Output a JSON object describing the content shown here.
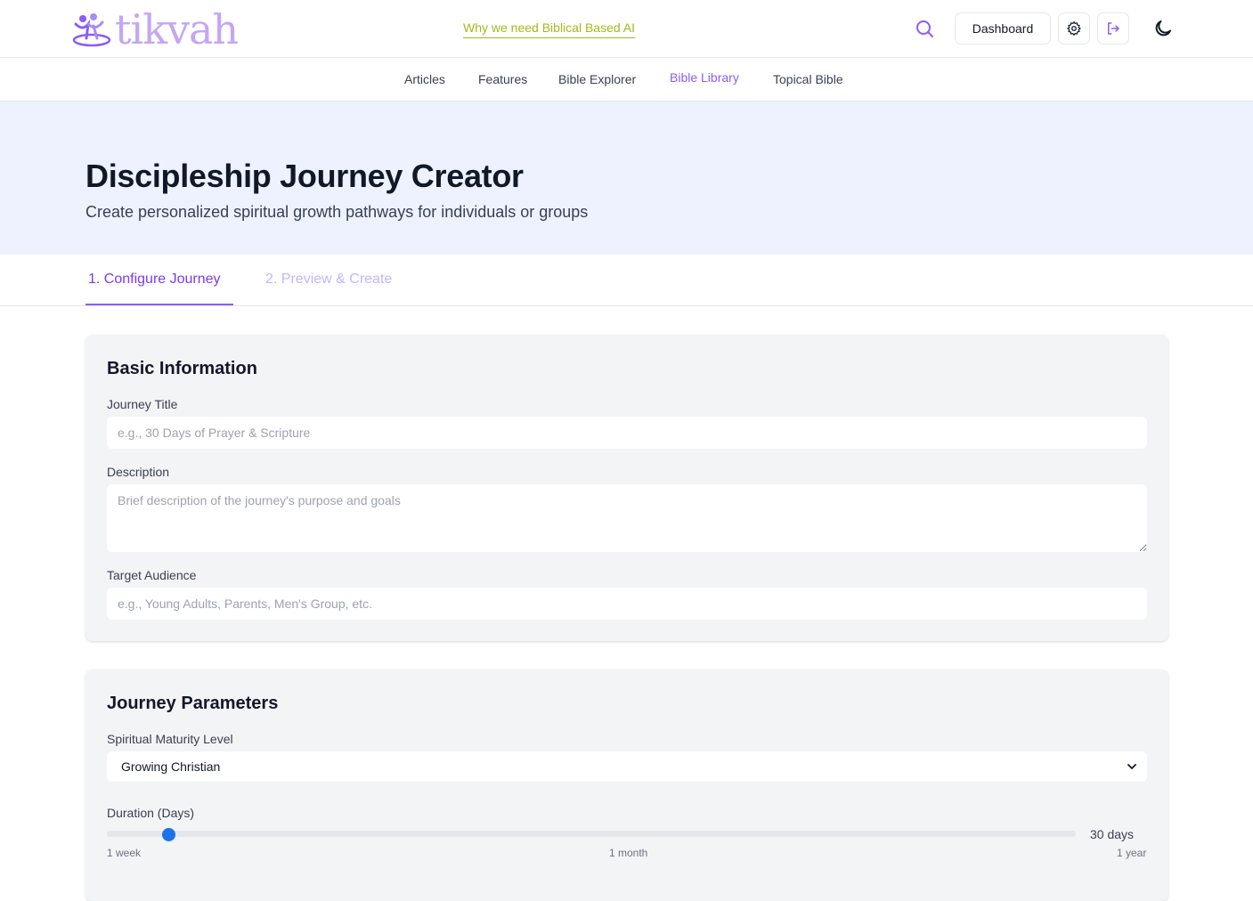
{
  "header": {
    "logo_text": "tikvah",
    "promo_link": "Why we need Biblical Based AI",
    "dashboard_label": "Dashboard",
    "icons": [
      "search-icon",
      "gear-icon",
      "logout-icon",
      "moon-icon"
    ],
    "accent_color": "#8b5cf6",
    "promo_color": "#a3b91a"
  },
  "nav": {
    "items": [
      "Articles",
      "Features",
      "Bible Explorer",
      "Bible Library",
      "Topical Bible"
    ],
    "active": "Bible Library"
  },
  "hero": {
    "title": "Discipleship Journey Creator",
    "subtitle": "Create personalized spiritual growth pathways for individuals or groups"
  },
  "tabs": [
    {
      "label": "1. Configure Journey",
      "active": true
    },
    {
      "label": "2. Preview & Create",
      "active": false
    }
  ],
  "basic_info": {
    "heading": "Basic Information",
    "title_label": "Journey Title",
    "title_placeholder": "e.g., 30 Days of Prayer & Scripture",
    "description_label": "Description",
    "description_placeholder": "Brief description of the journey's purpose and goals",
    "audience_label": "Target Audience",
    "audience_placeholder": "e.g., Young Adults, Parents, Men's Group, etc."
  },
  "parameters": {
    "heading": "Journey Parameters",
    "maturity_label": "Spiritual Maturity Level",
    "maturity_value": "Growing Christian",
    "duration_label": "Duration (Days)",
    "duration_value": "30 days",
    "duration_days": 30,
    "duration_min_days": 7,
    "duration_max_days": 365,
    "tick_labels": [
      "1 week",
      "1 month",
      "1 year"
    ]
  }
}
